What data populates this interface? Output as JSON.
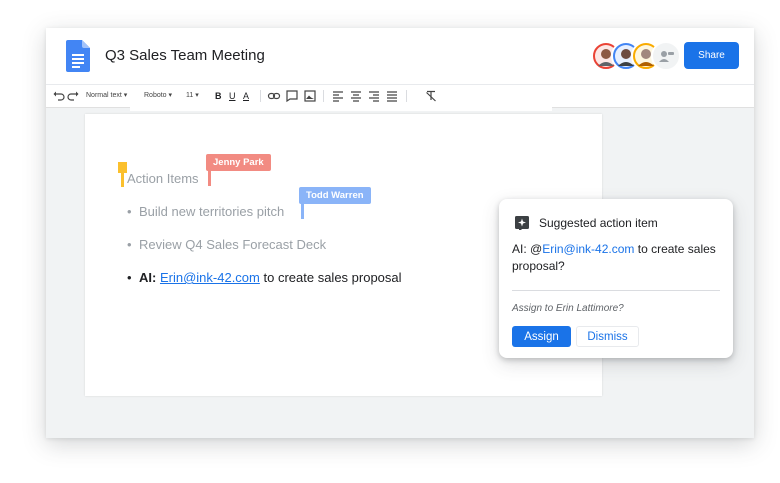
{
  "document": {
    "title": "Q3 Sales Team Meeting"
  },
  "header": {
    "share_label": "Share"
  },
  "collaborators": [
    {
      "name": "avatar-1",
      "color": "#ea4335"
    },
    {
      "name": "avatar-2",
      "color": "#4285f4"
    },
    {
      "name": "avatar-3",
      "color": "#f9ab00"
    },
    {
      "name": "add-people",
      "color": "#dadce0"
    }
  ],
  "toolbar": {
    "style": "Normal text",
    "font": "Roboto",
    "size": "11",
    "bold": "B",
    "underline": "U",
    "text_color": "A"
  },
  "cursors": [
    {
      "name": "Jenny Park",
      "color": "#f28b82"
    },
    {
      "name": "Todd Warren",
      "color": "#8ab4f8"
    }
  ],
  "content": {
    "heading": "Action Items",
    "items": [
      "Build new territories pitch",
      "Review Q4 Sales Forecast Deck"
    ],
    "ai_item": {
      "label": "AI:",
      "link": "Erin@ink-42.com",
      "text": "to create sales proposal"
    }
  },
  "suggestion": {
    "title": "Suggested action item",
    "body_prefix": "AI: @",
    "body_link": "Erin@ink-42.com",
    "body_suffix": " to create sales proposal?",
    "question": "Assign to Erin Lattimore?",
    "assign_label": "Assign",
    "dismiss_label": "Dismiss"
  },
  "colors": {
    "accent": "#1a73e8",
    "jenny_cursor": "#f28b82",
    "todd_cursor": "#8ab4f8",
    "own_cursor": "#fbc02d"
  }
}
